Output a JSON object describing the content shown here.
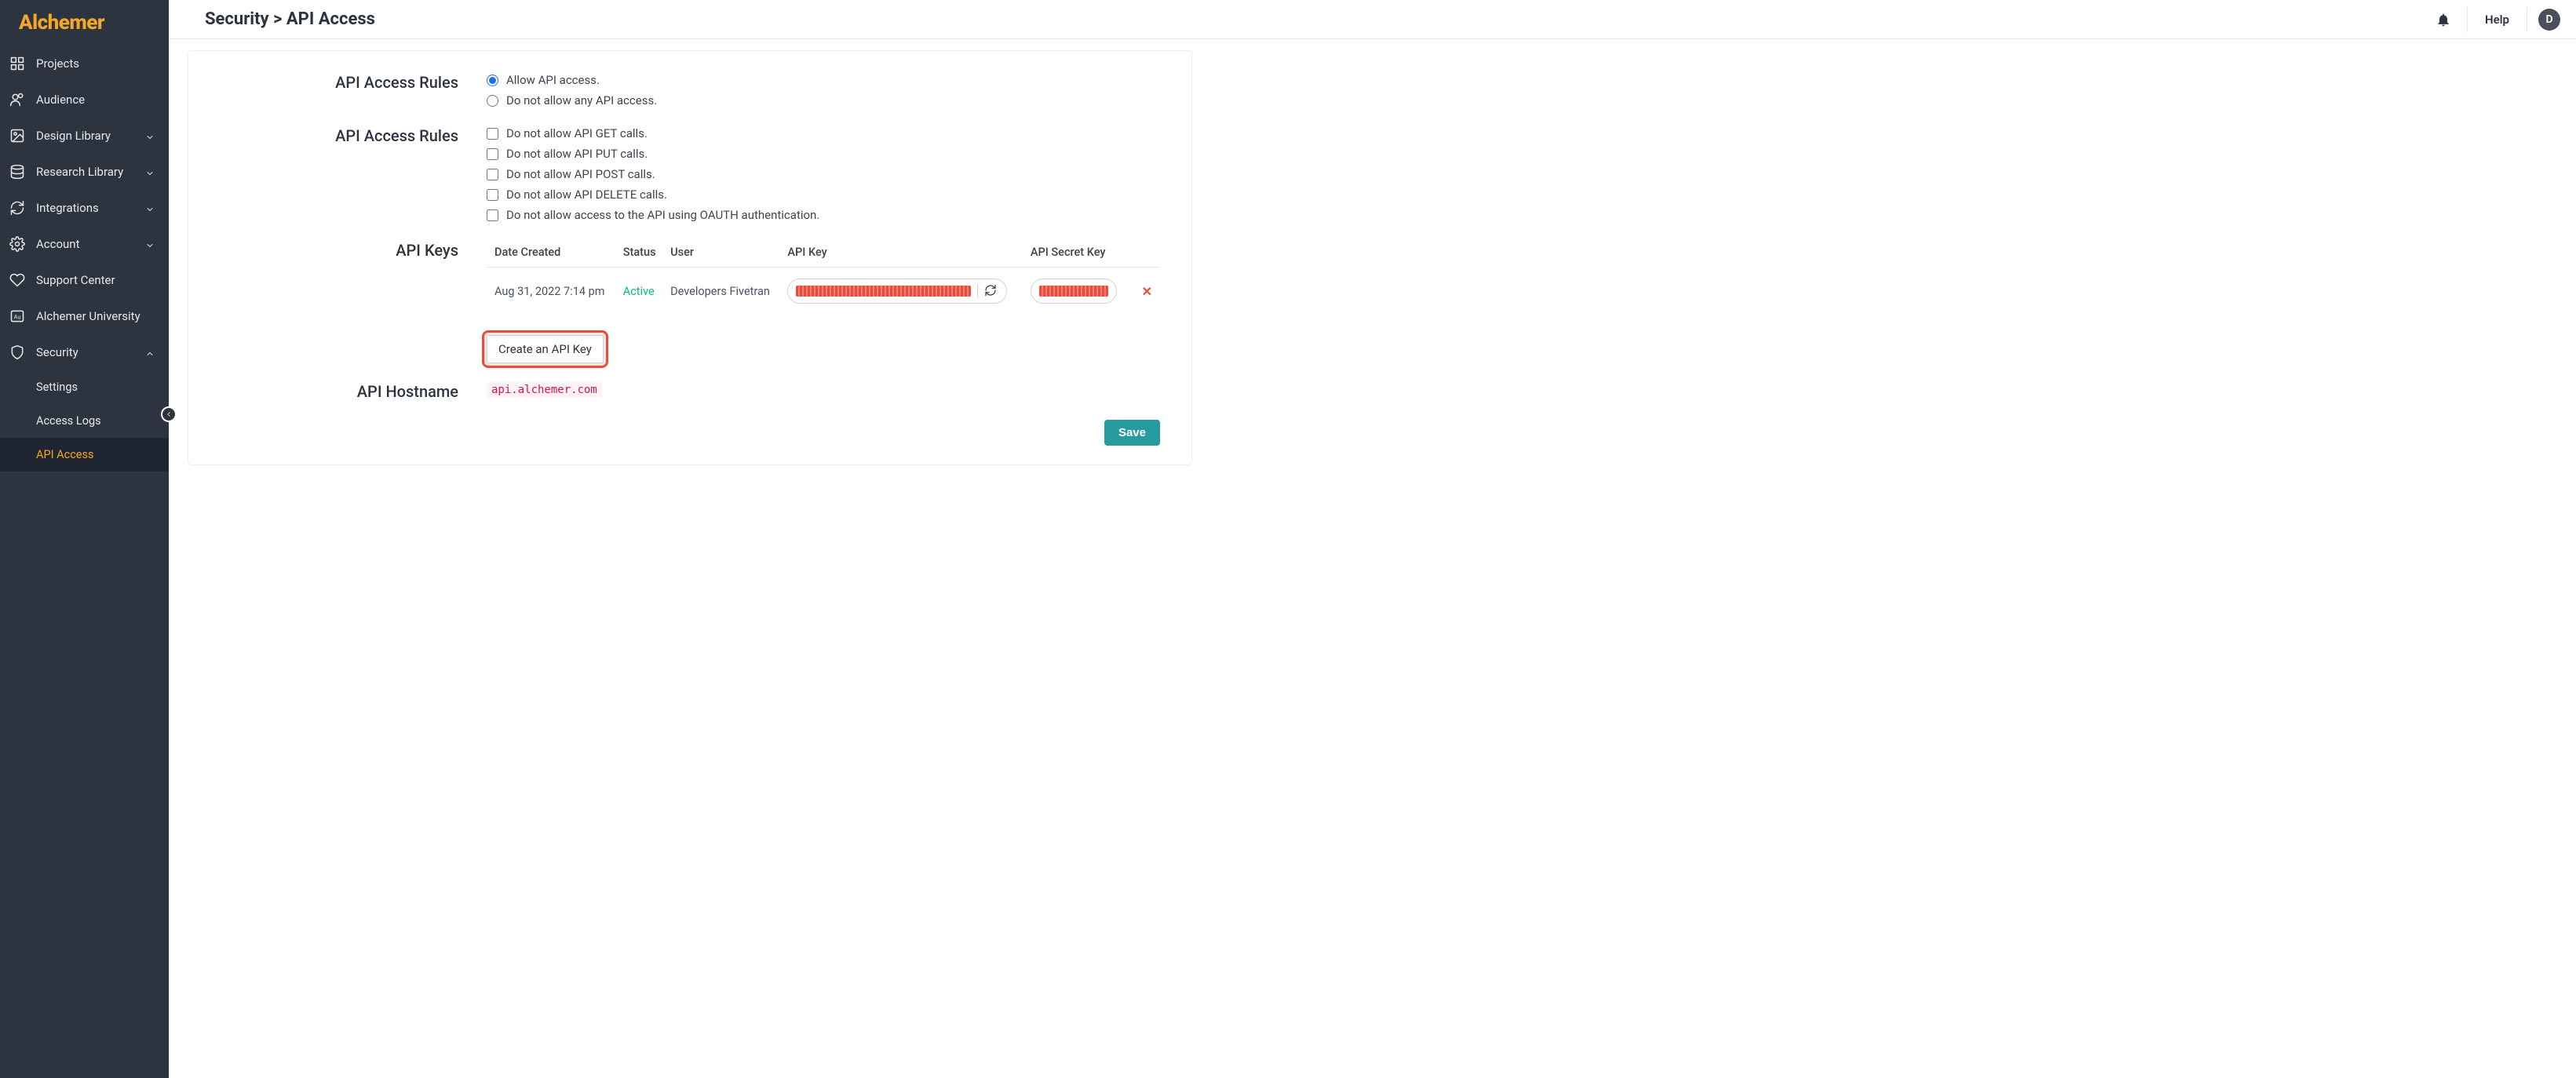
{
  "brand": "Alchemer",
  "breadcrumb": "Security > API Access",
  "topbar": {
    "help": "Help",
    "avatar_initial": "D"
  },
  "sidebar": {
    "items": [
      {
        "label": "Projects"
      },
      {
        "label": "Audience"
      },
      {
        "label": "Design Library"
      },
      {
        "label": "Research Library"
      },
      {
        "label": "Integrations"
      },
      {
        "label": "Account"
      },
      {
        "label": "Support Center"
      },
      {
        "label": "Alchemer University"
      },
      {
        "label": "Security"
      }
    ],
    "security_sub": [
      {
        "label": "Settings"
      },
      {
        "label": "Access Logs"
      },
      {
        "label": "API Access"
      }
    ]
  },
  "sections": {
    "access_rules_label": "API Access Rules",
    "access_allow": "Allow API access.",
    "access_deny": "Do not allow any API access.",
    "rules2_label": "API Access Rules",
    "rule_get": "Do not allow API GET calls.",
    "rule_put": "Do not allow API PUT calls.",
    "rule_post": "Do not allow API POST calls.",
    "rule_delete": "Do not allow API DELETE calls.",
    "rule_oauth": "Do not allow access to the API using OAUTH authentication.",
    "api_keys_label": "API Keys",
    "table": {
      "h_date": "Date Created",
      "h_status": "Status",
      "h_user": "User",
      "h_key": "API Key",
      "h_secret": "API Secret Key",
      "rows": [
        {
          "date": "Aug 31, 2022 7:14 pm",
          "status": "Active",
          "user": "Developers Fivetran"
        }
      ]
    },
    "create_key": "Create an API Key",
    "hostname_label": "API Hostname",
    "hostname": "api.alchemer.com",
    "save": "Save"
  }
}
